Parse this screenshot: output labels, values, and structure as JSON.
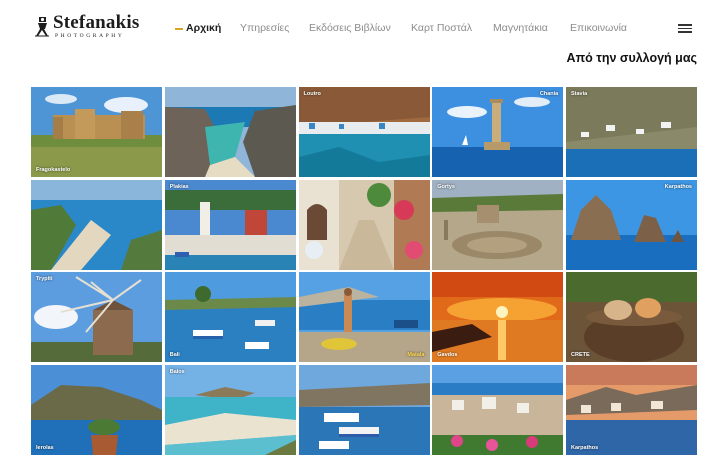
{
  "brand": {
    "name": "Stefanakis",
    "tagline": "PHOTOGRAPHY"
  },
  "nav": {
    "items": [
      {
        "label": "Αρχική",
        "active": true
      },
      {
        "label": "Υπηρεσίες"
      },
      {
        "label": "Εκδόσεις Βιβλίων"
      },
      {
        "label": "Καρτ Ποστάλ"
      },
      {
        "label": "Μαγνητάκια"
      },
      {
        "label": "Επικοινωνία"
      }
    ],
    "menu_icon": "hamburger-menu-icon"
  },
  "section": {
    "title": "Από την συλλογή μας"
  },
  "gallery": {
    "tiles": [
      {
        "caption": "Fragokastelo"
      },
      {
        "caption": ""
      },
      {
        "caption": "Loutro"
      },
      {
        "caption": "Chania"
      },
      {
        "caption": "Stavia"
      },
      {
        "caption": ""
      },
      {
        "caption": "Plakias"
      },
      {
        "caption": ""
      },
      {
        "caption": "Gortys"
      },
      {
        "caption": "Karpathos"
      },
      {
        "caption": "Trypiti"
      },
      {
        "caption": "Bali"
      },
      {
        "caption": "Matala"
      },
      {
        "caption": "Gavdos"
      },
      {
        "caption": "CRETE"
      },
      {
        "caption": "Ierolas"
      },
      {
        "caption": "Balos"
      },
      {
        "caption": ""
      },
      {
        "caption": ""
      },
      {
        "caption": "Karpathos"
      }
    ]
  },
  "colors": {
    "accent": "#d9a326",
    "nav_inactive": "#8c8c8c",
    "text_dark": "#1e1e1e"
  }
}
